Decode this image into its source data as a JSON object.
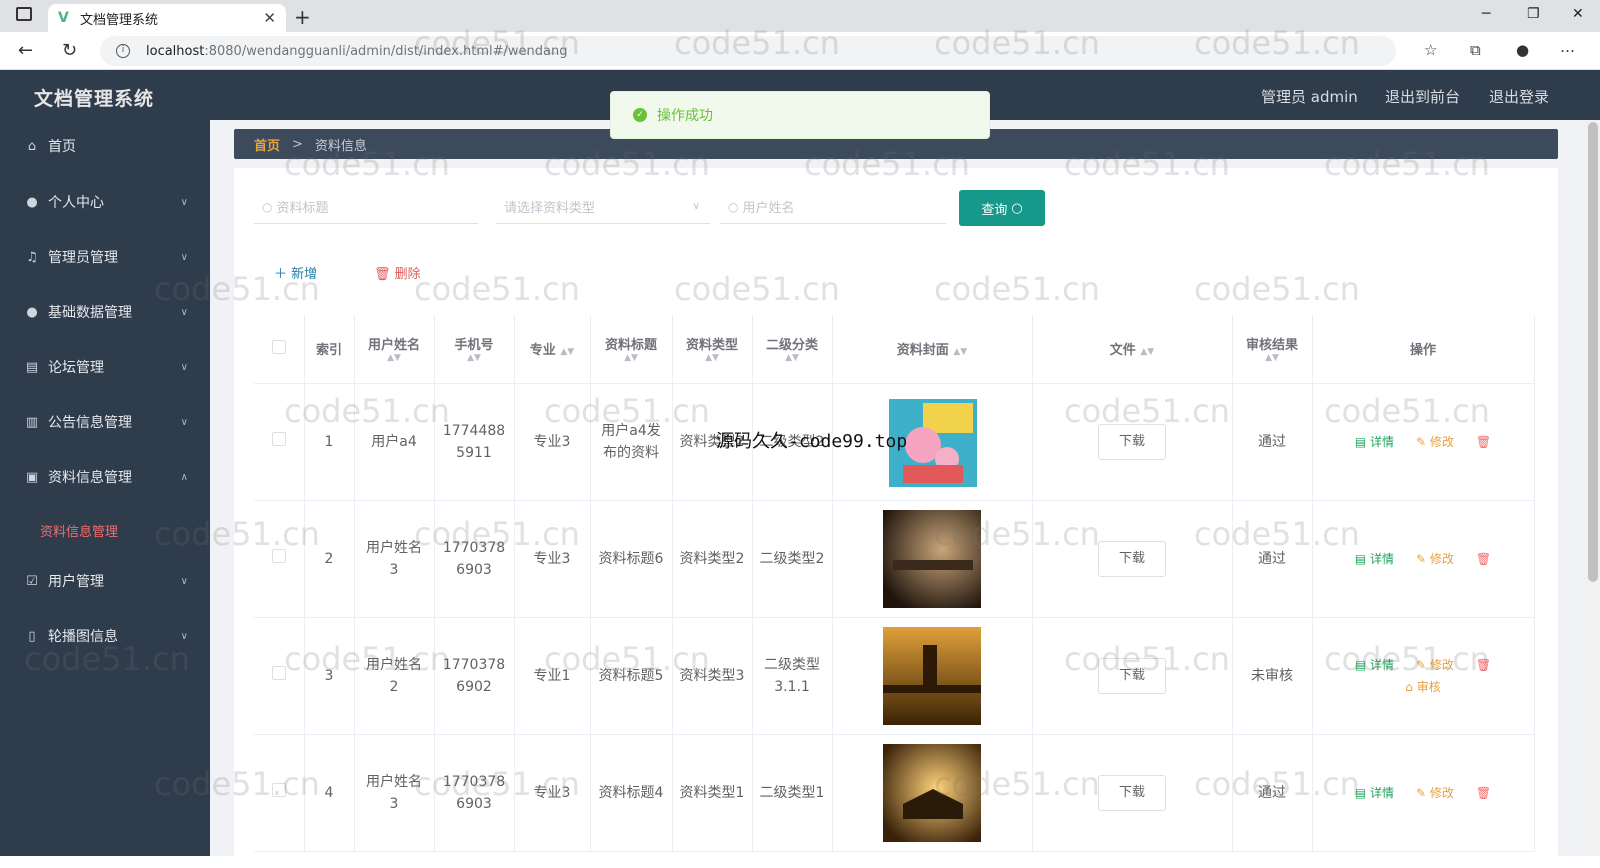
{
  "browser": {
    "tab_title": "文档管理系统",
    "url_host": "localhost",
    "url_path": ":8080/wendangguanli/admin/dist/index.html#/wendang"
  },
  "app": {
    "brand": "文档管理系统",
    "user_label": "管理员 admin",
    "to_front": "退出到前台",
    "logout": "退出登录"
  },
  "sidebar": {
    "items": [
      {
        "label": "首页",
        "icon": "home-icon"
      },
      {
        "label": "个人中心",
        "icon": "user-icon"
      },
      {
        "label": "管理员管理",
        "icon": "mic-icon"
      },
      {
        "label": "基础数据管理",
        "icon": "user-icon"
      },
      {
        "label": "论坛管理",
        "icon": "briefcase-icon"
      },
      {
        "label": "公告信息管理",
        "icon": "chart-icon"
      },
      {
        "label": "资料信息管理",
        "icon": "folder-icon"
      },
      {
        "label": "用户管理",
        "icon": "check-icon"
      },
      {
        "label": "轮播图信息",
        "icon": "phone-icon"
      }
    ],
    "active_sub": "资料信息管理"
  },
  "breadcrumb": {
    "home": "首页",
    "sep": ">",
    "current": "资料信息"
  },
  "toast": {
    "text": "操作成功"
  },
  "search": {
    "title_placeholder": "资料标题",
    "type_placeholder": "请选择资料类型",
    "user_placeholder": "用户姓名",
    "query_label": "查询"
  },
  "actions": {
    "add": "新增",
    "delete": "删除"
  },
  "table": {
    "headers": [
      "索引",
      "用户姓名",
      "手机号",
      "专业",
      "资料标题",
      "资料类型",
      "二级分类",
      "资料封面",
      "文件",
      "审核结果",
      "操作"
    ],
    "rows": [
      {
        "idx": "1",
        "name": "用户a4",
        "phone": "17744885911",
        "major": "专业3",
        "title": "用户a4发布的资料",
        "type": "资料类型2",
        "sub": "二级类型2",
        "file": "下载",
        "status": "通过"
      },
      {
        "idx": "2",
        "name": "用户姓名3",
        "phone": "17703786903",
        "major": "专业3",
        "title": "资料标题6",
        "type": "资料类型2",
        "sub": "二级类型2",
        "file": "下载",
        "status": "通过"
      },
      {
        "idx": "3",
        "name": "用户姓名2",
        "phone": "17703786902",
        "major": "专业1",
        "title": "资料标题5",
        "type": "资料类型3",
        "sub": "二级类型3.1.1",
        "file": "下载",
        "status": "未审核"
      },
      {
        "idx": "4",
        "name": "用户姓名3",
        "phone": "17703786903",
        "major": "专业3",
        "title": "资料标题4",
        "type": "资料类型1",
        "sub": "二级类型1",
        "file": "下载",
        "status": "通过"
      }
    ],
    "op_detail": "详情",
    "op_edit": "修改",
    "op_audit": "审核"
  },
  "overlay_text": "源码久久-code99.top",
  "watermark": "code51.cn"
}
